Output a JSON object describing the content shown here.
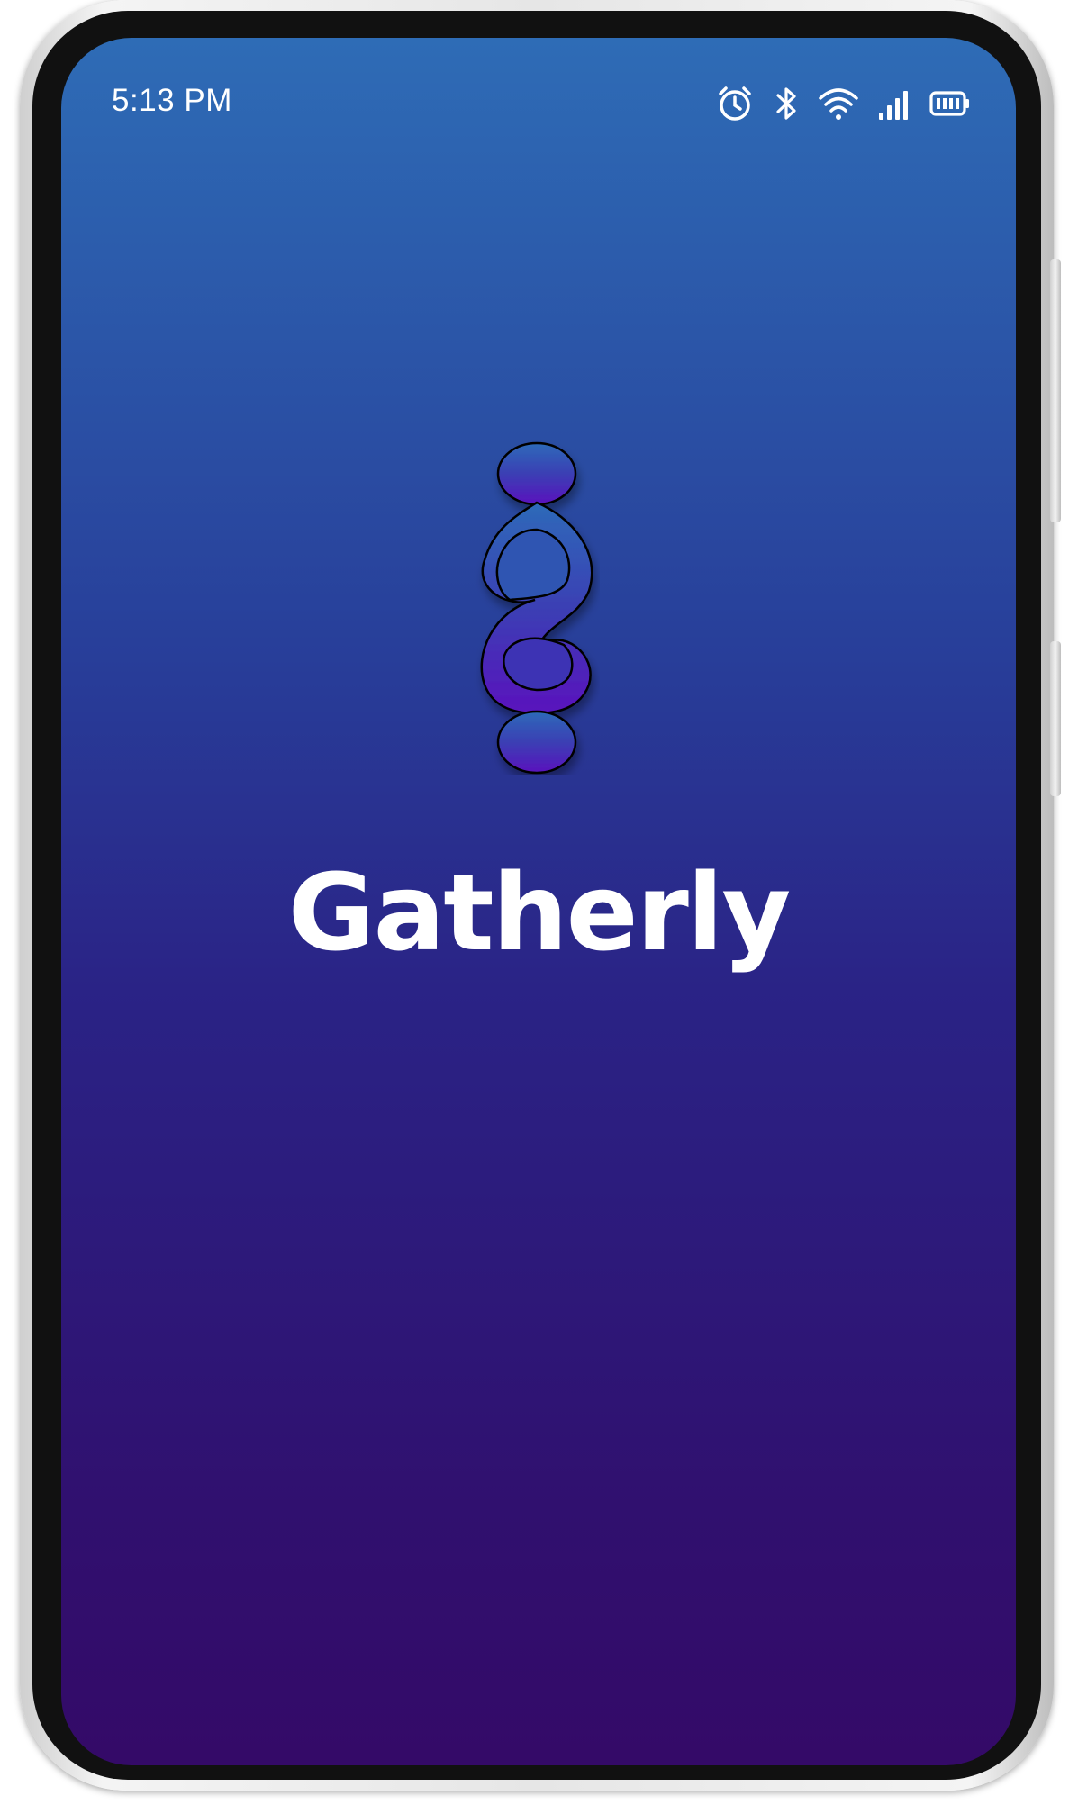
{
  "app": {
    "name": "Gatherly"
  },
  "status_bar": {
    "time": "5:13 PM",
    "icons": [
      "alarm-icon",
      "bluetooth-icon",
      "wifi-icon",
      "signal-icon",
      "battery-icon"
    ]
  },
  "logo": {
    "icon": "gatherly-logo-icon",
    "colors": {
      "top": "#2d6ab9",
      "bottom": "#5a12bd",
      "outline": "#000000"
    }
  },
  "theme": {
    "gradient_top": "#2e6cb6",
    "gradient_bottom": "#340a68",
    "text_color": "#ffffff"
  }
}
